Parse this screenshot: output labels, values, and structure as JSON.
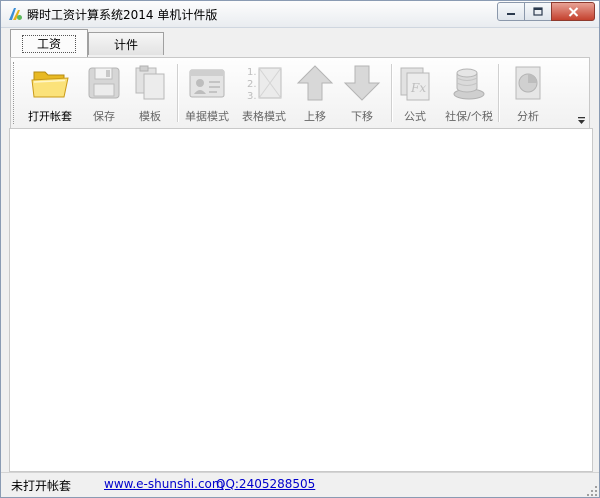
{
  "window": {
    "title": "瞬时工资计算系统2014 单机计件版"
  },
  "tabs": [
    {
      "label": "工资",
      "active": true
    },
    {
      "label": "计件",
      "active": false
    }
  ],
  "toolbar": {
    "items": [
      {
        "label": "打开帐套",
        "icon": "folder-icon",
        "enabled": true
      },
      {
        "label": "保存",
        "icon": "floppy-disk-icon",
        "enabled": false
      },
      {
        "label": "模板",
        "icon": "copy-documents-icon",
        "enabled": false
      },
      {
        "label": "单据模式",
        "icon": "id-card-icon",
        "enabled": false
      },
      {
        "label": "表格模式",
        "icon": "numbered-list-icon",
        "enabled": false
      },
      {
        "label": "上移",
        "icon": "arrow-up-icon",
        "enabled": false
      },
      {
        "label": "下移",
        "icon": "arrow-down-icon",
        "enabled": false
      },
      {
        "label": "公式",
        "icon": "formula-fx-icon",
        "enabled": false
      },
      {
        "label": "社保/个税",
        "icon": "coin-stack-icon",
        "enabled": false
      },
      {
        "label": "分析",
        "icon": "pie-chart-icon",
        "enabled": false
      }
    ]
  },
  "statusbar": {
    "status": "未打开帐套",
    "website": "www.e-shunshi.com",
    "qq": "QQ:2405288505"
  },
  "colors": {
    "link": "#0000cc",
    "disabled_icon": "#c4c4c4",
    "folder": "#f7d54a",
    "close_button": "#c4412e"
  }
}
